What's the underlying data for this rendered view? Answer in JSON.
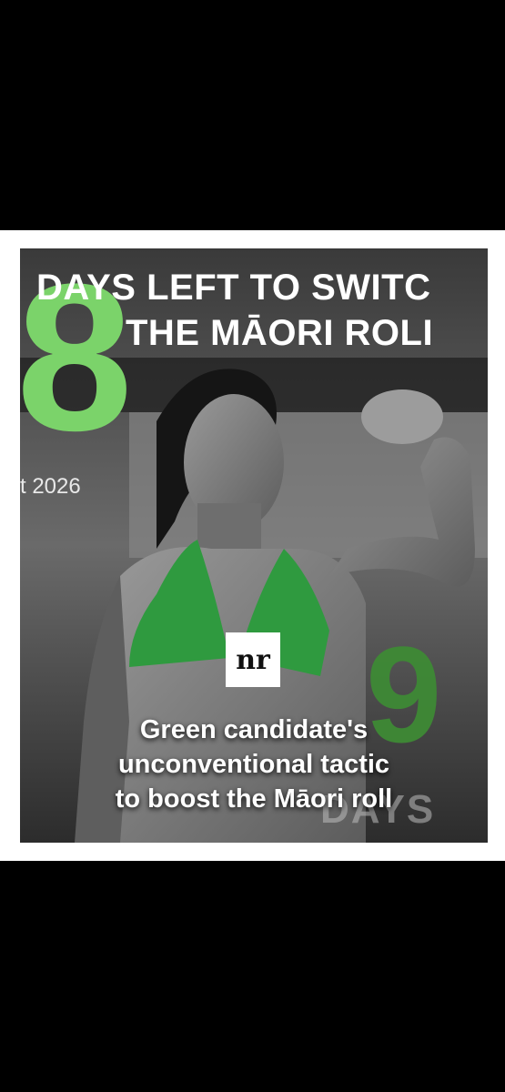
{
  "post": {
    "headline_line1": "DAYS LEFT TO SWITC",
    "headline_line2": "THE MĀORI ROLI",
    "big_number": "8",
    "second_number": "9",
    "date_fragment": "t 2026",
    "days_fragment": "DAYS",
    "logo_text": "nr",
    "caption_lines": [
      "Green candidate's",
      "unconventional tactic",
      "to boost the Māori roll"
    ]
  },
  "colors": {
    "accent_green": "#7bd36a",
    "bikini_green": "#2f9a3f",
    "background": "#000000",
    "frame": "#ffffff"
  }
}
